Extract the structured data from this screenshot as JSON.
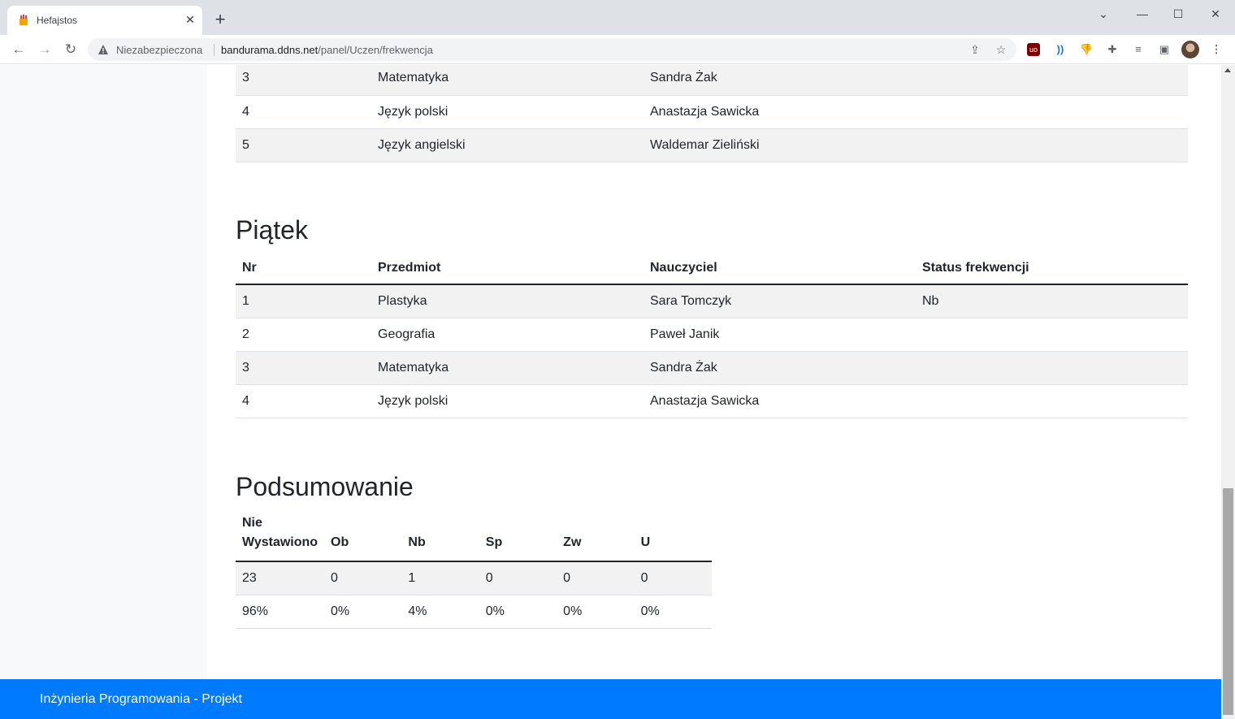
{
  "browser": {
    "tab_title": "Hefajstos",
    "security_label": "Niezabezpieczona",
    "url_host": "bandurama.ddns.net",
    "url_path": "/panel/Uczen/frekwencja"
  },
  "top_table": {
    "rows": [
      {
        "nr": "3",
        "subject": "Matematyka",
        "teacher": "Sandra Żak",
        "status": ""
      },
      {
        "nr": "4",
        "subject": "Język polski",
        "teacher": "Anastazja Sawicka",
        "status": ""
      },
      {
        "nr": "5",
        "subject": "Język angielski",
        "teacher": "Waldemar Zieliński",
        "status": ""
      }
    ]
  },
  "piatek": {
    "title": "Piątek",
    "headers": {
      "nr": "Nr",
      "subject": "Przedmiot",
      "teacher": "Nauczyciel",
      "status": "Status frekwencji"
    },
    "rows": [
      {
        "nr": "1",
        "subject": "Plastyka",
        "teacher": "Sara Tomczyk",
        "status": "Nb"
      },
      {
        "nr": "2",
        "subject": "Geografia",
        "teacher": "Paweł Janik",
        "status": ""
      },
      {
        "nr": "3",
        "subject": "Matematyka",
        "teacher": "Sandra Żak",
        "status": ""
      },
      {
        "nr": "4",
        "subject": "Język polski",
        "teacher": "Anastazja Sawicka",
        "status": ""
      }
    ]
  },
  "summary": {
    "title": "Podsumowanie",
    "headers": {
      "nw_line1": "Nie",
      "nw_line2": "Wystawiono",
      "ob": "Ob",
      "nb": "Nb",
      "sp": "Sp",
      "zw": "Zw",
      "u": "U"
    },
    "counts": {
      "nw": "23",
      "ob": "0",
      "nb": "1",
      "sp": "0",
      "zw": "0",
      "u": "0"
    },
    "percents": {
      "nw": "96%",
      "ob": "0%",
      "nb": "4%",
      "sp": "0%",
      "zw": "0%",
      "u": "0%"
    }
  },
  "footer": {
    "text": "Inżynieria Programowania - Projekt"
  },
  "colors": {
    "footer_bg": "#007bff",
    "row_stripe": "#f2f2f2",
    "sidebar_bg": "#f8f9fa"
  }
}
